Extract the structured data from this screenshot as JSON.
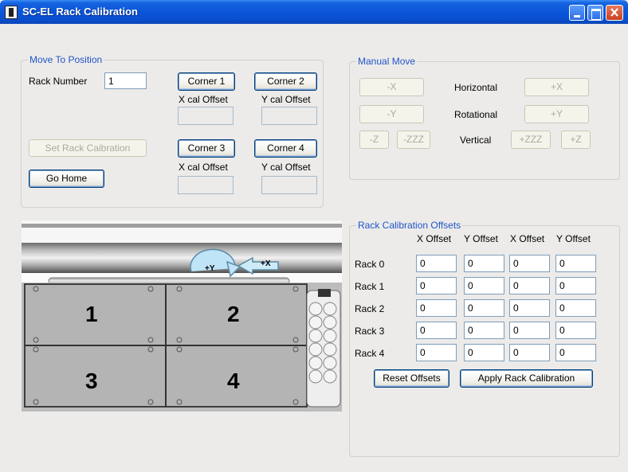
{
  "window": {
    "title": "SC-EL Rack Calibration"
  },
  "move_to_position": {
    "title": "Move To Position",
    "rack_number_label": "Rack Number",
    "rack_number_value": "1",
    "corner1": "Corner 1",
    "corner2": "Corner 2",
    "corner3": "Corner 3",
    "corner4": "Corner 4",
    "x_cal_offset": "X cal Offset",
    "y_cal_offset": "Y cal Offset",
    "set_rack_calibration": "Set Rack Caibration",
    "go_home": "Go Home"
  },
  "manual_move": {
    "title": "Manual Move",
    "minus_x": "-X",
    "plus_x": "+X",
    "minus_y": "-Y",
    "plus_y": "+Y",
    "minus_z": "-Z",
    "minus_zzz": "-ZZZ",
    "plus_zzz": "+ZZZ",
    "plus_z": "+Z",
    "horizontal": "Horizontal",
    "rotational": "Rotational",
    "vertical": "Vertical"
  },
  "rack_image": {
    "rotate_label": "+Y",
    "arrow_label": "+X",
    "racks": [
      "1",
      "2",
      "3",
      "4"
    ]
  },
  "rack_calibration_offsets": {
    "title": "Rack Calibration Offsets",
    "headers": [
      "X Offset",
      "Y Offset",
      "X Offset",
      "Y Offset"
    ],
    "rows": [
      {
        "label": "Rack 0",
        "values": [
          "0",
          "0",
          "0",
          "0"
        ]
      },
      {
        "label": "Rack 1",
        "values": [
          "0",
          "0",
          "0",
          "0"
        ]
      },
      {
        "label": "Rack 2",
        "values": [
          "0",
          "0",
          "0",
          "0"
        ]
      },
      {
        "label": "Rack 3",
        "values": [
          "0",
          "0",
          "0",
          "0"
        ]
      },
      {
        "label": "Rack 4",
        "values": [
          "0",
          "0",
          "0",
          "0"
        ]
      }
    ],
    "reset_offsets": "Reset Offsets",
    "apply_rack_calibration": "Apply Rack Calibration"
  }
}
